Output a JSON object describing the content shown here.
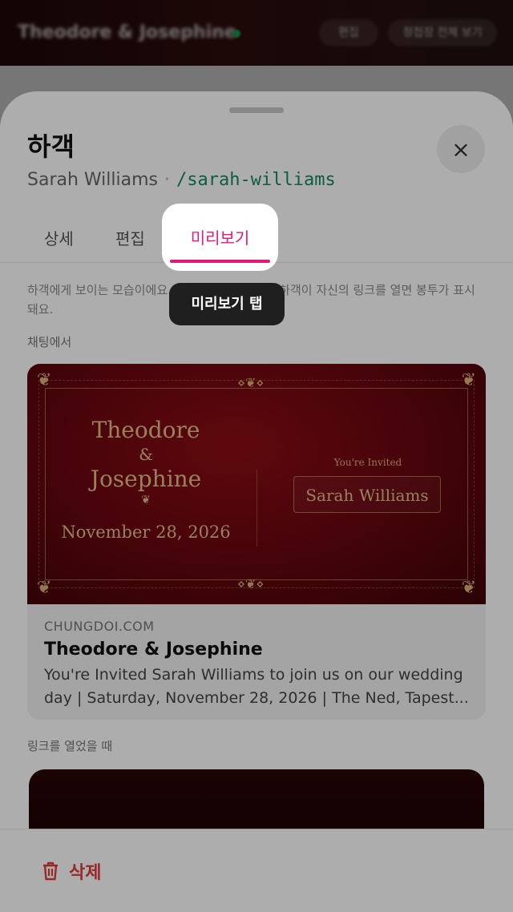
{
  "background": {
    "header_title": "Theodore & Josephine",
    "pill1": "편집",
    "pill2": "청첩장 전체 보기"
  },
  "sheet": {
    "title": "하객",
    "guest_name": "Sarah Williams",
    "separator": "·",
    "slug": "/sarah-williams",
    "close_icon": "×"
  },
  "tabs": [
    {
      "label": "상세",
      "active": false
    },
    {
      "label": "편집",
      "active": false
    },
    {
      "label": "미리보기",
      "active": true
    }
  ],
  "description": "하객에게 보이는 모습이에요. 채팅에 링크 카드가, 하객이 자신의 링크를 열면 봉투가 표시돼요.",
  "sections": {
    "chat": "채팅에서",
    "opened": "링크를 열었을 때"
  },
  "link_card": {
    "image": {
      "name1": "Theodore",
      "ampersand": "&",
      "name2": "Josephine",
      "heart": "❦",
      "date": "November 28, 2026",
      "invited": "You're Invited",
      "guest": "Sarah Williams",
      "ornament": "❦",
      "center_ornament": "⋄❦⋄"
    },
    "domain": "CHUNGDOI.COM",
    "title": "Theodore & Josephine",
    "description": "You're Invited Sarah Williams to join us on our wedding day | Saturday, November 28, 2026 | The Ned, Tapest..."
  },
  "bottom": {
    "delete_label": "삭제",
    "delete_icon": "trash-icon"
  },
  "tooltip": {
    "text": "미리보기 탭"
  },
  "colors": {
    "accent": "#e0197d",
    "slug": "#168a5a",
    "danger": "#e23b3b",
    "card_gold": "#e2bf8a",
    "card_red": "#6b0710"
  }
}
